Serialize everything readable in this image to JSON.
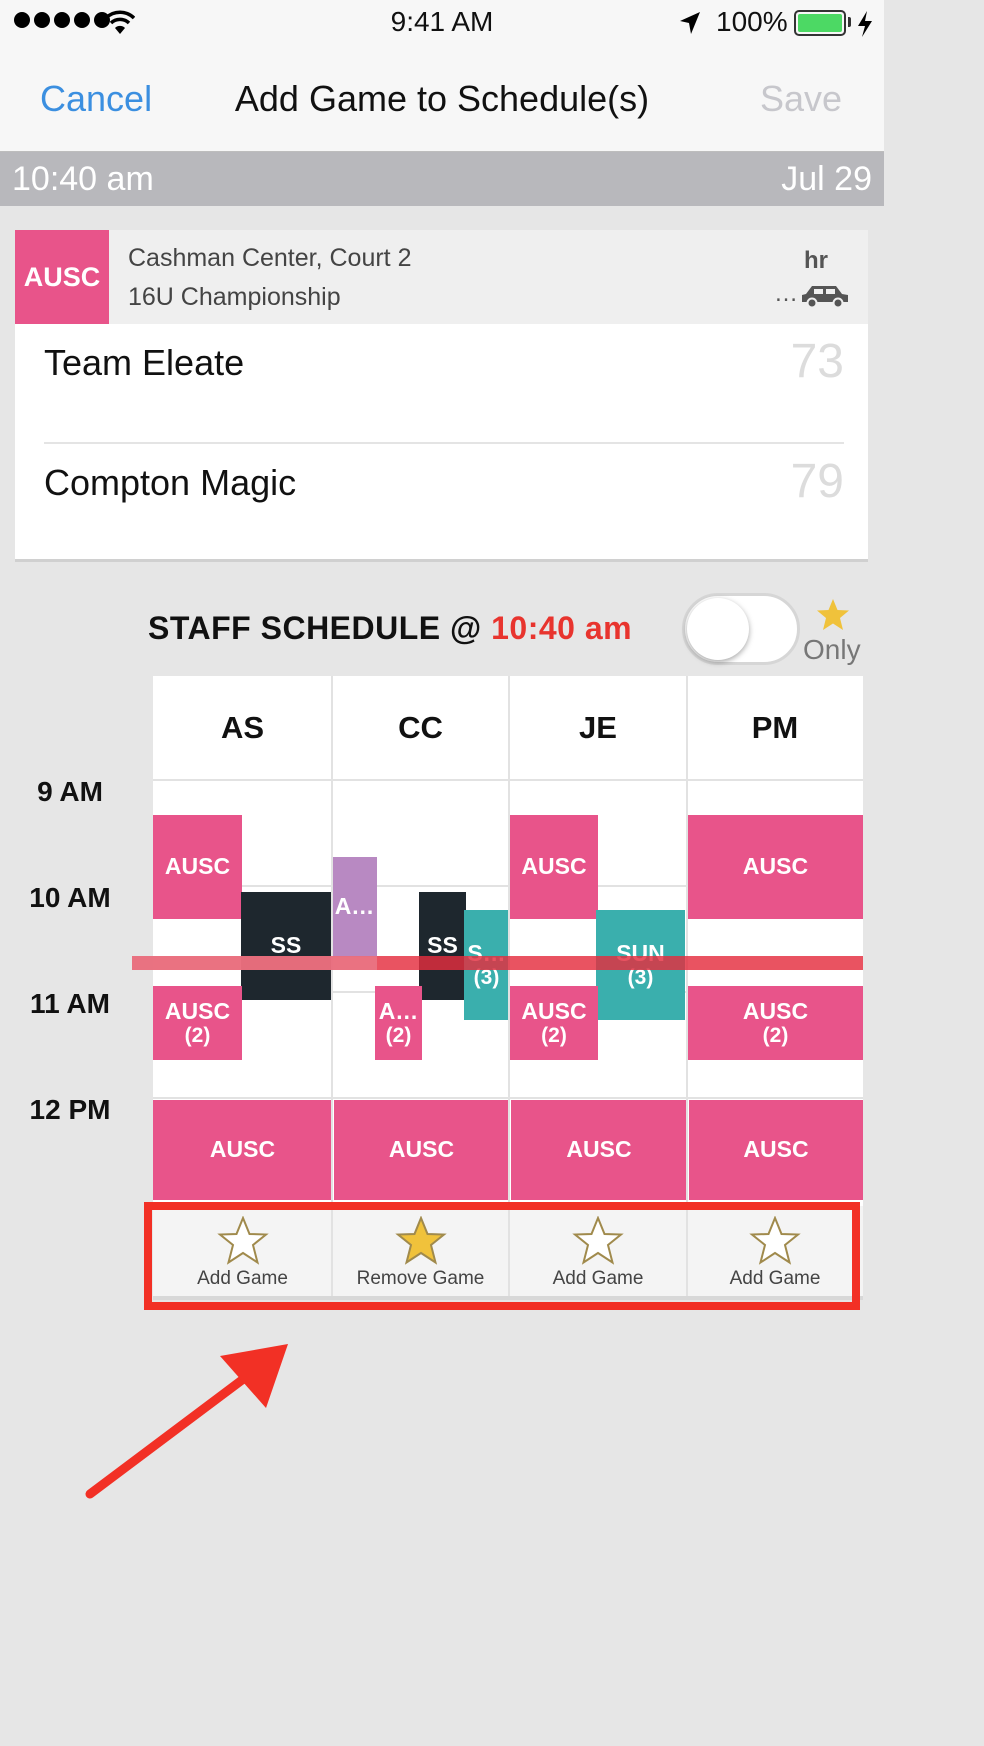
{
  "status_bar": {
    "time": "9:41 AM",
    "battery": "100%"
  },
  "nav": {
    "cancel": "Cancel",
    "title": "Add Game to Schedule(s)",
    "save": "Save"
  },
  "time_bar": {
    "time": "10:40 am",
    "date": "Jul 29"
  },
  "game": {
    "org": "AUSC",
    "venue": "Cashman Center, Court 2",
    "division": "16U Championship",
    "travel_label": "hr",
    "travel_value": "…",
    "teams": [
      {
        "name": "Team Eleate",
        "score": "73"
      },
      {
        "name": "Compton Magic",
        "score": "79"
      }
    ]
  },
  "staff": {
    "title": "STAFF SCHEDULE @",
    "time": "10:40 am",
    "starred_only_label": "Only",
    "starred_only_enabled": false,
    "columns": [
      "AS",
      "CC",
      "JE",
      "PM"
    ],
    "hours": [
      "9 AM",
      "10 AM",
      "11 AM",
      "12 PM"
    ],
    "events": {
      "as_ausc_1": "AUSC",
      "as_ss": "SS",
      "as_ausc_2": "AUSC",
      "as_ausc_2_count": "(2)",
      "as_ausc_noon": "AUSC",
      "cc_a_1": "A…",
      "cc_ss": "SS",
      "cc_s": "S…",
      "cc_s_count": "(3)",
      "cc_a_2": "A…",
      "cc_a_2_count": "(2)",
      "cc_ausc_noon": "AUSC",
      "je_ausc_1": "AUSC",
      "je_sun": "SUN",
      "je_sun_count": "(3)",
      "je_ausc_2": "AUSC",
      "je_ausc_2_count": "(2)",
      "je_ausc_noon": "AUSC",
      "pm_ausc_1": "AUSC",
      "pm_ausc_2": "AUSC",
      "pm_ausc_2_count": "(2)",
      "pm_ausc_noon": "AUSC"
    },
    "actions": [
      {
        "label": "Add Game",
        "starred": false
      },
      {
        "label": "Remove Game",
        "starred": true
      },
      {
        "label": "Add Game",
        "starred": false
      },
      {
        "label": "Add Game",
        "starred": false
      }
    ]
  },
  "colors": {
    "accent_blue": "#3b8fe0",
    "brand_pink": "#e8548a",
    "now_red": "#e8342e",
    "teal": "#3aafad",
    "dark": "#1e272e",
    "lavender": "#b889c2",
    "star_gold": "#f0c23b",
    "highlight_red": "#f23025"
  }
}
